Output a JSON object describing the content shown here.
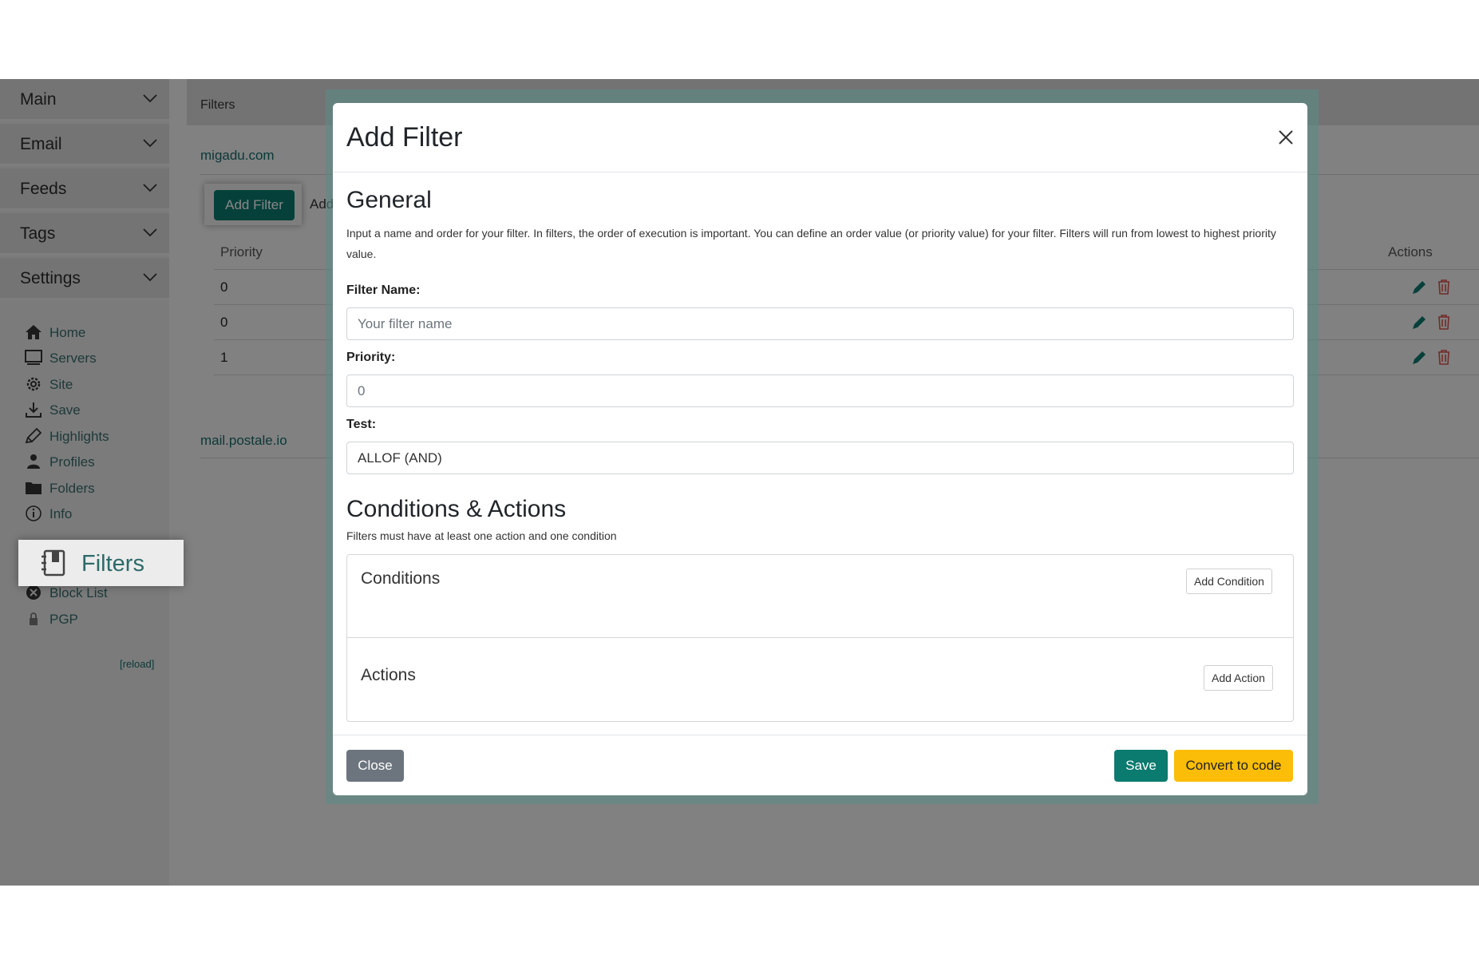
{
  "sidebar": {
    "sections": [
      {
        "label": "Main"
      },
      {
        "label": "Email"
      },
      {
        "label": "Feeds"
      },
      {
        "label": "Tags"
      },
      {
        "label": "Settings"
      }
    ],
    "items": [
      {
        "label": "Home",
        "icon": "home-icon"
      },
      {
        "label": "Servers",
        "icon": "monitor-icon"
      },
      {
        "label": "Site",
        "icon": "gear-icon"
      },
      {
        "label": "Save",
        "icon": "download-icon"
      },
      {
        "label": "Highlights",
        "icon": "pencil-icon"
      },
      {
        "label": "Profiles",
        "icon": "person-icon"
      },
      {
        "label": "Folders",
        "icon": "folder-icon"
      },
      {
        "label": "Info",
        "icon": "info-icon"
      },
      {
        "label": "Block List",
        "icon": "x-circle-icon"
      },
      {
        "label": "PGP",
        "icon": "lock-icon"
      }
    ],
    "highlighted_item": {
      "label": "Filters",
      "icon": "journal-icon"
    },
    "reload_label": "[reload]"
  },
  "main": {
    "breadcrumb": "Filters",
    "domains": [
      "migadu.com",
      "mail.postale.io"
    ],
    "add_filter_label": "Add Filter",
    "add_secondary_label": "Add",
    "table": {
      "headers": {
        "priority": "Priority",
        "actions": "Actions"
      },
      "rows": [
        {
          "priority": "0"
        },
        {
          "priority": "0"
        },
        {
          "priority": "1"
        }
      ]
    }
  },
  "modal": {
    "title": "Add Filter",
    "general_heading": "General",
    "general_description": "Input a name and order for your filter. In filters, the order of execution is important. You can define an order value (or priority value) for your filter. Filters will run from lowest to highest priority value.",
    "filter_name_label": "Filter Name:",
    "filter_name_placeholder": "Your filter name",
    "filter_name_value": "",
    "priority_label": "Priority:",
    "priority_placeholder": "0",
    "test_label": "Test:",
    "test_value": "ALLOF (AND)",
    "ca_heading": "Conditions & Actions",
    "ca_description": "Filters must have at least one action and one condition",
    "conditions_title": "Conditions",
    "add_condition_label": "Add Condition",
    "actions_title": "Actions",
    "add_action_label": "Add Action",
    "close_label": "Close",
    "save_label": "Save",
    "convert_label": "Convert to code"
  },
  "colors": {
    "accent": "#0b7a6f",
    "warning": "#fbbd08",
    "secondary": "#6c757d",
    "danger": "#d9534f"
  }
}
